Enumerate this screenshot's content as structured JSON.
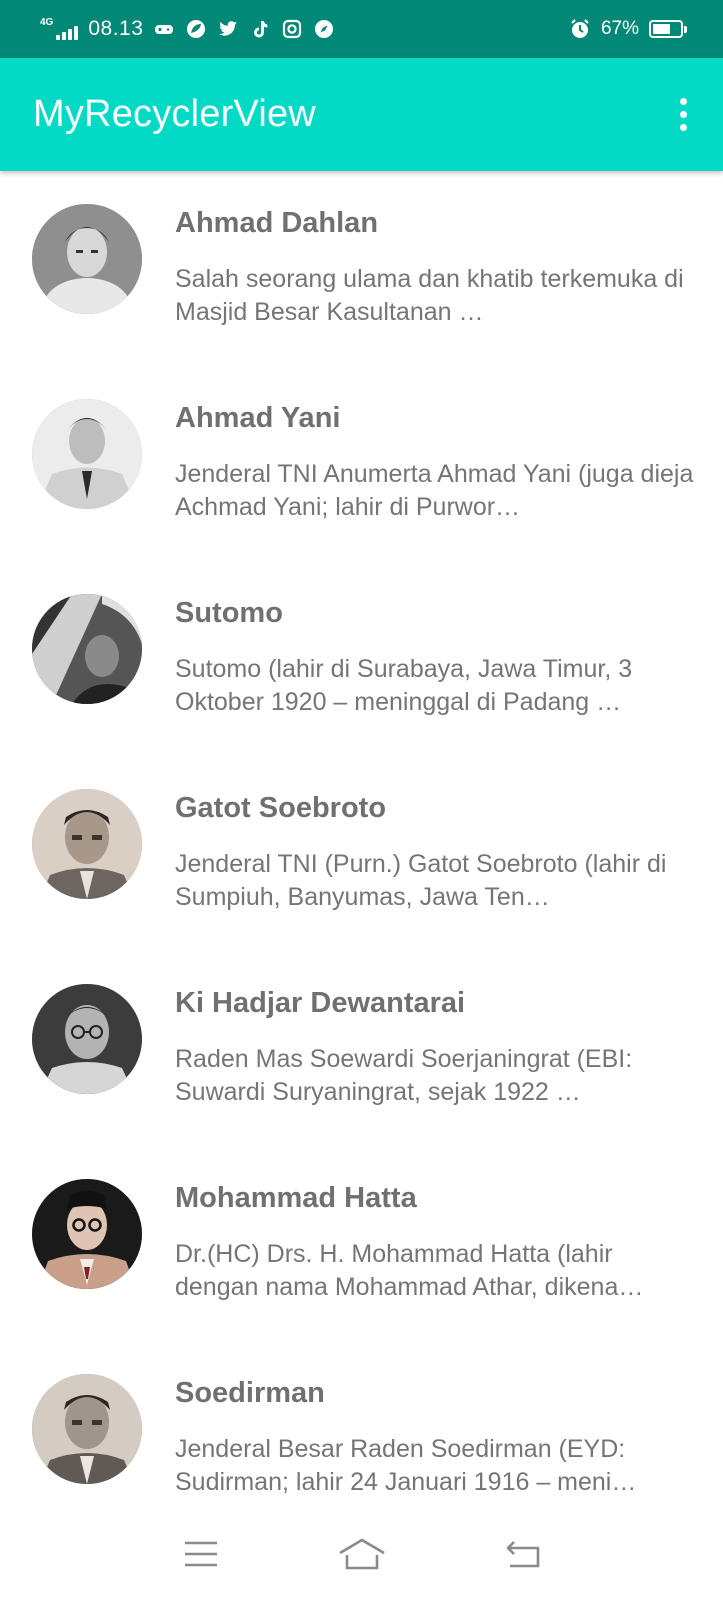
{
  "status_bar": {
    "network": "4G",
    "time": "08.13",
    "notification_icons": [
      "game-icon",
      "leaf-icon",
      "twitter-icon",
      "tiktok-icon",
      "instagram-icon",
      "compass-icon"
    ],
    "battery_percent": "67%",
    "battery_level": 0.67
  },
  "app_bar": {
    "title": "MyRecyclerView",
    "menu_icon": "overflow-menu-icon",
    "color": "#03dac5"
  },
  "heroes": [
    {
      "name": "Ahmad Dahlan",
      "description": "Salah seorang ulama dan khatib terkemuka di Masjid Besar Kasultanan …"
    },
    {
      "name": "Ahmad Yani",
      "description": "Jenderal TNI Anumerta Ahmad Yani (juga dieja Achmad Yani; lahir di Purwor…"
    },
    {
      "name": "Sutomo",
      "description": "Sutomo (lahir di Surabaya, Jawa Timur, 3 Oktober 1920 – meninggal di Padang …"
    },
    {
      "name": "Gatot Soebroto",
      "description": "Jenderal TNI (Purn.) Gatot Soebroto (lahir di Sumpiuh, Banyumas, Jawa Ten…"
    },
    {
      "name": "Ki Hadjar Dewantarai",
      "description": "Raden Mas Soewardi Soerjaningrat (EBI: Suwardi Suryaningrat, sejak 1922 …"
    },
    {
      "name": "Mohammad Hatta",
      "description": "Dr.(HC) Drs. H. Mohammad Hatta (lahir dengan nama Mohammad Athar, dikena…"
    },
    {
      "name": "Soedirman",
      "description": "Jenderal Besar Raden Soedirman (EYD: Sudirman; lahir 24 Januari 1916 – meni…"
    }
  ],
  "nav_bar": {
    "icons": [
      "menu-icon",
      "home-icon",
      "back-icon"
    ]
  }
}
